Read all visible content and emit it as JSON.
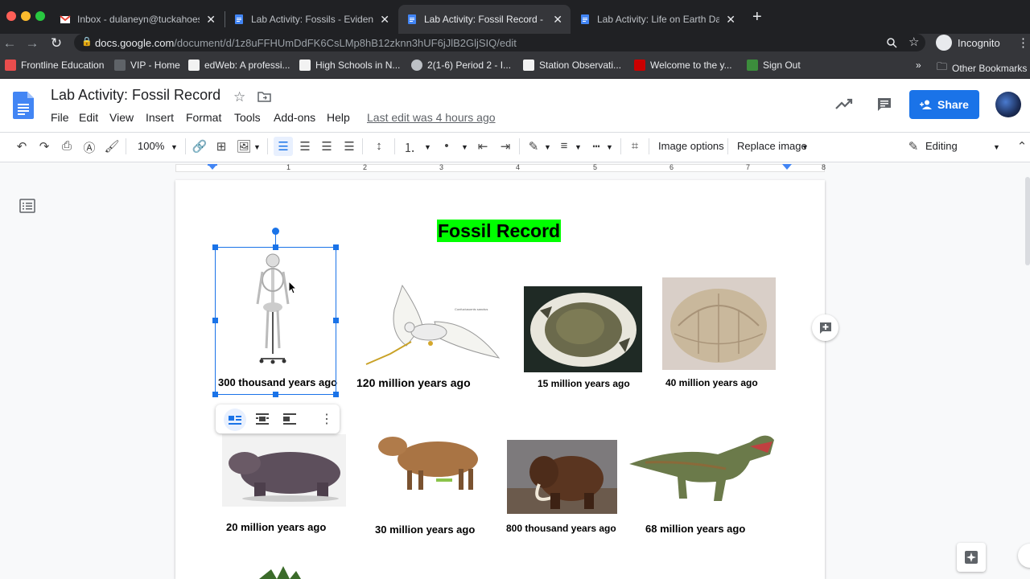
{
  "browser": {
    "tabs": [
      {
        "title": "Inbox - dulaneyn@tuckahoeschools.org",
        "favicon": "gmail-icon"
      },
      {
        "title": "Lab Activity: Fossils - Evidence",
        "favicon": "docs-icon"
      },
      {
        "title": "Lab Activity: Fossil Record - Google Docs",
        "favicon": "docs-icon"
      },
      {
        "title": "Lab Activity: Life on Earth Data",
        "favicon": "docs-icon"
      }
    ],
    "new_tab": "+",
    "url_host": "docs.google.com",
    "url_path": "/document/d/1z8uFFHUmDdFK6CsLMp8hB12zknn3hUF6jJlB2GljSIQ/edit",
    "profile_label": "Incognito",
    "bookmarks": [
      {
        "label": "Frontline Education",
        "color": "#e94d4d"
      },
      {
        "label": "VIP - Home",
        "color": "#202124"
      },
      {
        "label": "edWeb: A professi...",
        "color": "#f2f2f2"
      },
      {
        "label": "High Schools in N...",
        "color": "#f2f2f2"
      },
      {
        "label": "2(1-6) Period 2 - I...",
        "color": "#bdc1c6"
      },
      {
        "label": "Station Observati...",
        "color": "#f2f2f2"
      },
      {
        "label": "Welcome to the y...",
        "color": "#cc0000"
      },
      {
        "label": "Sign Out",
        "color": "#3c8d3c"
      }
    ],
    "more_bookmarks": "»",
    "other_bookmarks": "Other Bookmarks"
  },
  "docs": {
    "title": "Lab Activity: Fossil Record",
    "menus": [
      "File",
      "Edit",
      "View",
      "Insert",
      "Format",
      "Tools",
      "Add-ons",
      "Help"
    ],
    "last_edit": "Last edit was 4 hours ago",
    "share_label": "Share",
    "zoom": "100%",
    "image_options": "Image options",
    "replace_image": "Replace image",
    "mode": "Editing",
    "ruler_numbers": [
      "1",
      "2",
      "3",
      "4",
      "5",
      "6",
      "7",
      "8"
    ]
  },
  "document": {
    "heading": "Fossil Record",
    "fossils": [
      {
        "caption": "300 thousand years ago",
        "subject": "human-skeleton"
      },
      {
        "caption": "120 million years ago",
        "subject": "bird"
      },
      {
        "caption": "15 million years ago",
        "subject": "fossil-in-rock"
      },
      {
        "caption": "40 million years ago",
        "subject": "turtle-shell"
      },
      {
        "caption": "20 million years ago",
        "subject": "hippo-like-mammal"
      },
      {
        "caption": "30 million years ago",
        "subject": "tapir-like-mammal"
      },
      {
        "caption": "800 thousand years ago",
        "subject": "mammoth"
      },
      {
        "caption": "68 million years ago",
        "subject": "t-rex"
      }
    ]
  },
  "colors": {
    "share": "#1a73e8",
    "heading_highlight": "#00ff00",
    "selection": "#1a73e8"
  }
}
